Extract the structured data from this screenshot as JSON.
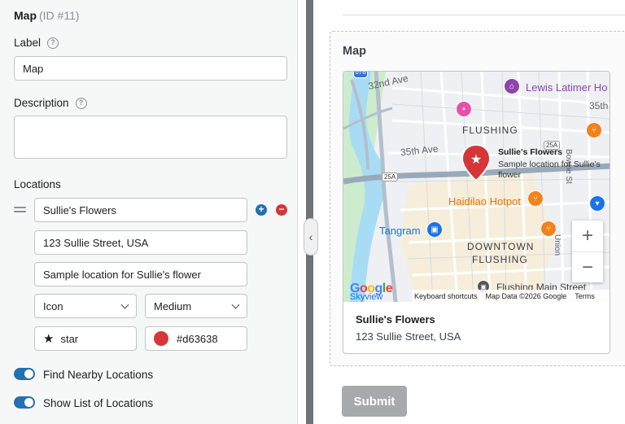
{
  "panel": {
    "title": "Map",
    "title_id": "(ID #11)",
    "label_heading": "Label",
    "label_value": "Map",
    "description_heading": "Description",
    "description_value": "",
    "locations_heading": "Locations",
    "location": {
      "name": "Sullie's Flowers",
      "address": "123 Sullie Street, USA",
      "description": "Sample location for Sullie's flower",
      "marker_type": "Icon",
      "marker_size": "Medium",
      "icon_name": "star",
      "color": "#d63638"
    },
    "toggles": [
      {
        "label": "Find Nearby Locations",
        "on": true
      },
      {
        "label": "Show List of Locations",
        "on": true
      }
    ]
  },
  "preview": {
    "title": "Map",
    "map": {
      "labels": {
        "street_32nd": "32nd Ave",
        "lewis_latimer": "Lewis Latimer Ho",
        "street_35th_right": "35th",
        "flushing": "FLUSHING",
        "street_35th": "35th Ave",
        "route_25a_top": "25A",
        "route_25a_left": "25A",
        "route_678": "678",
        "bowne": "Bowne St",
        "haidilao": "Haidilao Hotpot",
        "tangram": "Tangram",
        "downtown_1": "DOWNTOWN",
        "downtown_2": "FLUSHING",
        "union": "Union",
        "flushing_main": "Flushing Main Street",
        "skyview": "Skyview"
      },
      "info": {
        "name": "Sullie's Flowers",
        "desc_line1": "Sample location for Sullie's",
        "desc_line2": "flower"
      },
      "zoom_in": "+",
      "zoom_out": "−",
      "google": "Google",
      "keyboard": "Keyboard shortcuts",
      "map_data": "Map Data ©2026 Google",
      "terms": "Terms"
    },
    "card": {
      "name": "Sullie's Flowers",
      "address": "123 Sullie Street, USA"
    },
    "submit_label": "Submit"
  },
  "colors": {
    "accent": "#2271b1",
    "marker": "#d63638",
    "submit_disabled": "#a7aaad"
  }
}
